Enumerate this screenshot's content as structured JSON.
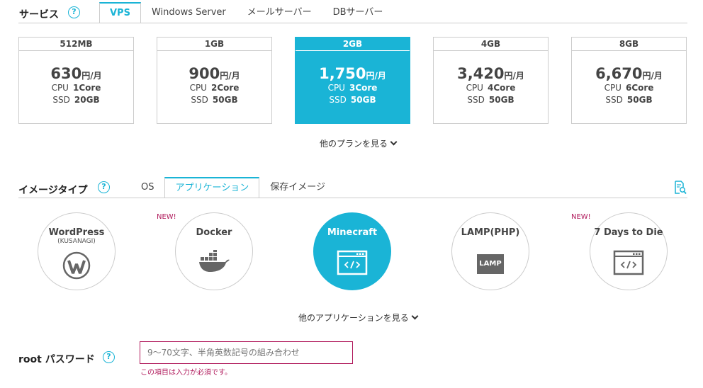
{
  "service": {
    "label": "サービス",
    "tabs": [
      "VPS",
      "Windows Server",
      "メールサーバー",
      "DBサーバー"
    ]
  },
  "plans": [
    {
      "name": "512MB",
      "price": "630",
      "unit": "円/月",
      "cpu_label": "CPU",
      "cpu": "1Core",
      "ssd_label": "SSD",
      "ssd": "20GB"
    },
    {
      "name": "1GB",
      "price": "900",
      "unit": "円/月",
      "cpu_label": "CPU",
      "cpu": "2Core",
      "ssd_label": "SSD",
      "ssd": "50GB"
    },
    {
      "name": "2GB",
      "price": "1,750",
      "unit": "円/月",
      "cpu_label": "CPU",
      "cpu": "3Core",
      "ssd_label": "SSD",
      "ssd": "50GB"
    },
    {
      "name": "4GB",
      "price": "3,420",
      "unit": "円/月",
      "cpu_label": "CPU",
      "cpu": "4Core",
      "ssd_label": "SSD",
      "ssd": "50GB"
    },
    {
      "name": "8GB",
      "price": "6,670",
      "unit": "円/月",
      "cpu_label": "CPU",
      "cpu": "6Core",
      "ssd_label": "SSD",
      "ssd": "50GB"
    }
  ],
  "more_plans": "他のプランを見る",
  "image_type": {
    "label": "イメージタイプ",
    "tabs": [
      "OS",
      "アプリケーション",
      "保存イメージ"
    ]
  },
  "apps": [
    {
      "name": "WordPress",
      "sub": "(KUSANAGI)",
      "icon": "wordpress-icon"
    },
    {
      "name": "Docker",
      "icon": "docker-icon",
      "badge": "NEW!"
    },
    {
      "name": "Minecraft",
      "icon": "code-window-icon"
    },
    {
      "name": "LAMP(PHP)",
      "icon": "lamp-icon",
      "icon_text": "LAMP"
    },
    {
      "name": "7 Days to Die",
      "icon": "code-window-icon",
      "badge": "NEW!"
    }
  ],
  "more_apps": "他のアプリケーションを見る",
  "password": {
    "label": "root パスワード",
    "placeholder": "9～70文字、半角英数記号の組み合わせ",
    "value": "",
    "error": "この項目は入力が必須です。"
  },
  "help_glyph": "?",
  "colors": {
    "accent": "#1ab4d6",
    "error": "#b0195b",
    "border": "#cccccc"
  }
}
